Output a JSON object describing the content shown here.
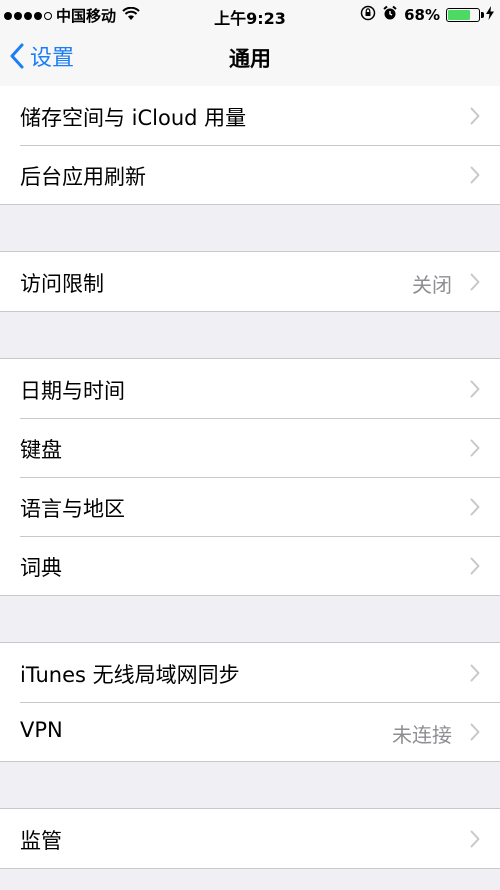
{
  "status_bar": {
    "carrier": "中国移动",
    "time": "上午9:23",
    "battery_text": "68%",
    "battery_level": 0.68,
    "battery_color": "#4cd964"
  },
  "nav": {
    "back_label": "设置",
    "title": "通用",
    "accent": "#1b7ef7"
  },
  "groups": [
    [
      {
        "label": "储存空间与 iCloud 用量",
        "value": ""
      },
      {
        "label": "后台应用刷新",
        "value": ""
      }
    ],
    [
      {
        "label": "访问限制",
        "value": "关闭"
      }
    ],
    [
      {
        "label": "日期与时间",
        "value": ""
      },
      {
        "label": "键盘",
        "value": ""
      },
      {
        "label": "语言与地区",
        "value": ""
      },
      {
        "label": "词典",
        "value": ""
      }
    ],
    [
      {
        "label": "iTunes 无线局域网同步",
        "value": ""
      },
      {
        "label": "VPN",
        "value": "未连接"
      }
    ],
    [
      {
        "label": "监管",
        "value": ""
      }
    ]
  ]
}
